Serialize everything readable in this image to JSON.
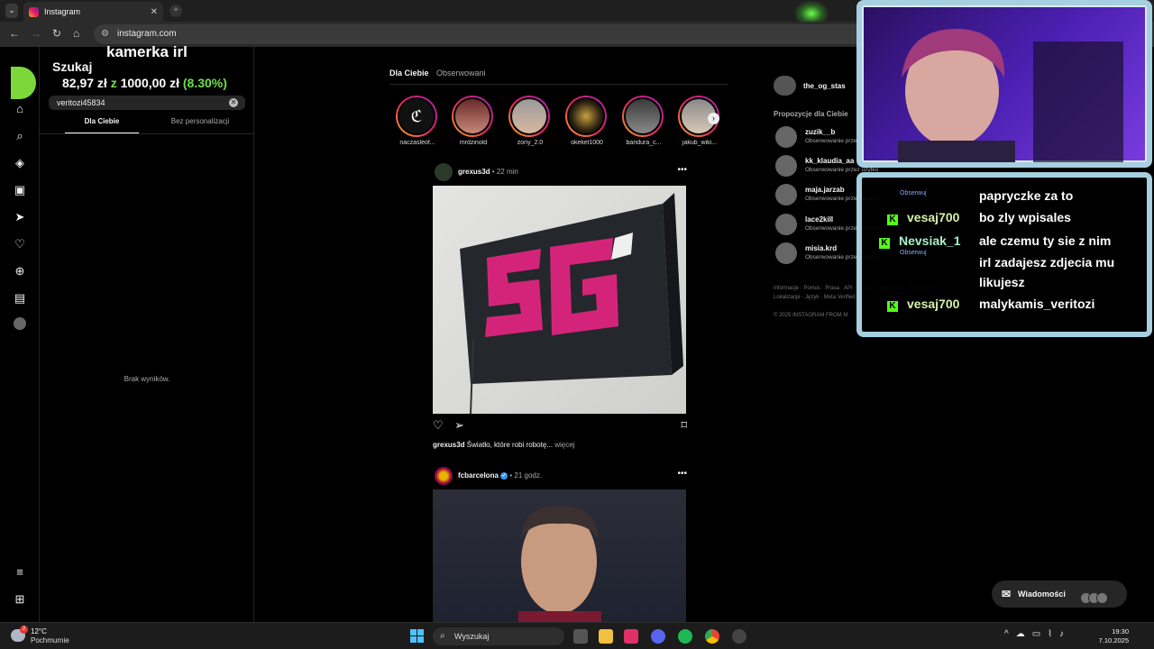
{
  "browser": {
    "tab_title": "Instagram",
    "url": "instagram.com"
  },
  "overlay": {
    "title": "kamerka irl",
    "price_current": "82,97 zł",
    "price_sep": "z",
    "price_goal": "1000,00 zł",
    "price_pct": "(8.30%)"
  },
  "search": {
    "title": "Szukaj",
    "query": "veritozi45834",
    "tab_for_you": "Dla Ciebie",
    "tab_no_personal": "Bez personalizacji",
    "no_results": "Brak wyników."
  },
  "feed": {
    "tab_for_you": "Dla Ciebie",
    "tab_following": "Obserwowani",
    "stories": [
      {
        "name": "naczasleof..."
      },
      {
        "name": "mrdzinold"
      },
      {
        "name": "zony_2.0"
      },
      {
        "name": "okekel1000"
      },
      {
        "name": "bandura_c..."
      },
      {
        "name": "jakub_wiki..."
      }
    ],
    "post1": {
      "user": "grexus3d",
      "time": " • 22 min",
      "caption_user": "grexus3d",
      "caption_text": " Światło, które robi robotę...",
      "caption_more": " więcej"
    },
    "post2": {
      "user": "fcbarcelona",
      "time": " • 21 godz."
    }
  },
  "right": {
    "username": "the_og_stas",
    "suggestions_title": "Propozycje dla Ciebie",
    "suggestions": [
      {
        "name": "zuzik__b",
        "sub": "Obserwowanie przez"
      },
      {
        "name": "kk_klaudia_aa",
        "sub": "Obserwowanie przez użytko"
      },
      {
        "name": "maja.jarzab",
        "sub": "Obserwowanie przez użytko"
      },
      {
        "name": "lace2kill",
        "sub": "Obserwowanie przez użytko"
      },
      {
        "name": "misia.krd",
        "sub": "Obserwowanie przez użytko"
      }
    ],
    "footer": "Informacje · Pomoc · Prasa · API · Praca · Prywatność · Regulamin · Lokalizacje · Język · Meta Verified",
    "copyright": "© 2025 INSTAGRAM FROM M"
  },
  "chat": {
    "follow_label": "Obserwuj",
    "lines": [
      {
        "user": "",
        "text": "papryczke za to"
      },
      {
        "user": "vesaj700",
        "text": "bo zly wpisales"
      },
      {
        "user": "Nevsiak_1",
        "text": "ale czemu ty sie z nim"
      },
      {
        "user": "",
        "text": "irl zadajesz zdjecia mu"
      },
      {
        "user": "",
        "text": "likujesz"
      },
      {
        "user": "vesaj700",
        "text": "malykamis_veritozi"
      }
    ]
  },
  "messages": {
    "label": "Wiadomości"
  },
  "taskbar": {
    "temp": "12°C",
    "condition": "Pochmurnie",
    "weather_badge": "2",
    "search_placeholder": "Wyszukaj",
    "time": "19:30",
    "date": "7.10.2025"
  },
  "colors": {
    "accent_green": "#6ee04a",
    "story_ring": "#e91e63",
    "kick_green": "#53fc18",
    "frame_ice": "#a6cfe0"
  }
}
